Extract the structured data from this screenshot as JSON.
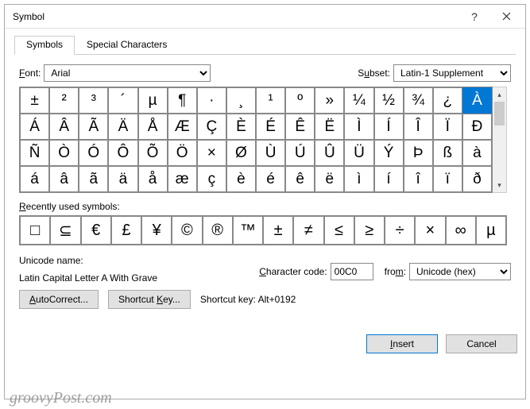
{
  "title": "Symbol",
  "tabs": {
    "symbols": "Symbols",
    "special": "Special Characters"
  },
  "font": {
    "label": "Font:",
    "value": "Arial"
  },
  "subset": {
    "label": "Subset:",
    "value": "Latin-1 Supplement"
  },
  "symbols": [
    [
      "±",
      "²",
      "³",
      "´",
      "µ",
      "¶",
      "·",
      "¸",
      "¹",
      "º",
      "»",
      "¼",
      "½",
      "¾",
      "¿",
      "À"
    ],
    [
      "Á",
      "Â",
      "Ã",
      "Ä",
      "Å",
      "Æ",
      "Ç",
      "È",
      "É",
      "Ê",
      "Ë",
      "Ì",
      "Í",
      "Î",
      "Ï",
      "Ð"
    ],
    [
      "Ñ",
      "Ò",
      "Ó",
      "Ô",
      "Õ",
      "Ö",
      "×",
      "Ø",
      "Ù",
      "Ú",
      "Û",
      "Ü",
      "Ý",
      "Þ",
      "ß",
      "à"
    ],
    [
      "á",
      "â",
      "ã",
      "ä",
      "å",
      "æ",
      "ç",
      "è",
      "é",
      "ê",
      "ë",
      "ì",
      "í",
      "î",
      "ï",
      "ð"
    ]
  ],
  "selected_row": 0,
  "selected_col": 15,
  "recent_label": "Recently used symbols:",
  "recent": [
    "□",
    "⊆",
    "€",
    "£",
    "¥",
    "©",
    "®",
    "™",
    "±",
    "≠",
    "≤",
    "≥",
    "÷",
    "×",
    "∞",
    "µ"
  ],
  "unicode_name_label": "Unicode name:",
  "unicode_name": "Latin Capital Letter A With Grave",
  "char_code_label": "Character code:",
  "char_code": "00C0",
  "from_label": "from:",
  "from_value": "Unicode (hex)",
  "autocorrect": "AutoCorrect...",
  "shortcut_key": "Shortcut Key...",
  "shortcut_display_label": "Shortcut key:",
  "shortcut_display": "Alt+0192",
  "insert": "Insert",
  "cancel": "Cancel",
  "watermark": "groovyPost.com"
}
